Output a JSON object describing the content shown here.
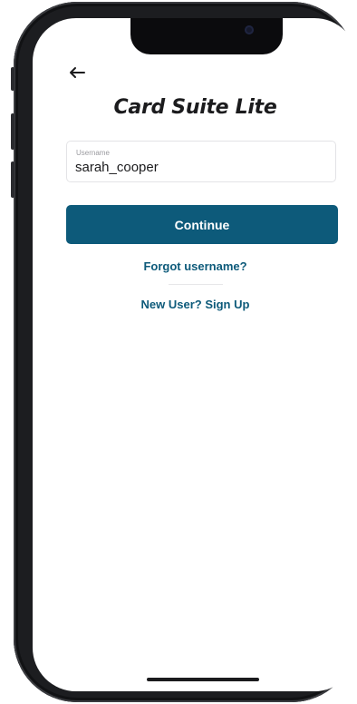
{
  "app": {
    "title": "Card Suite Lite"
  },
  "icons": {
    "back": "back-arrow-icon",
    "camera": "camera-icon"
  },
  "login": {
    "username_label": "Username",
    "username_value": "sarah_cooper",
    "continue_label": "Continue",
    "forgot_label": "Forgot username?",
    "signup_label": "New User? Sign Up"
  },
  "colors": {
    "accent": "#0d5a7a",
    "text": "#1b1b1d",
    "frame": "#1c1d20"
  }
}
